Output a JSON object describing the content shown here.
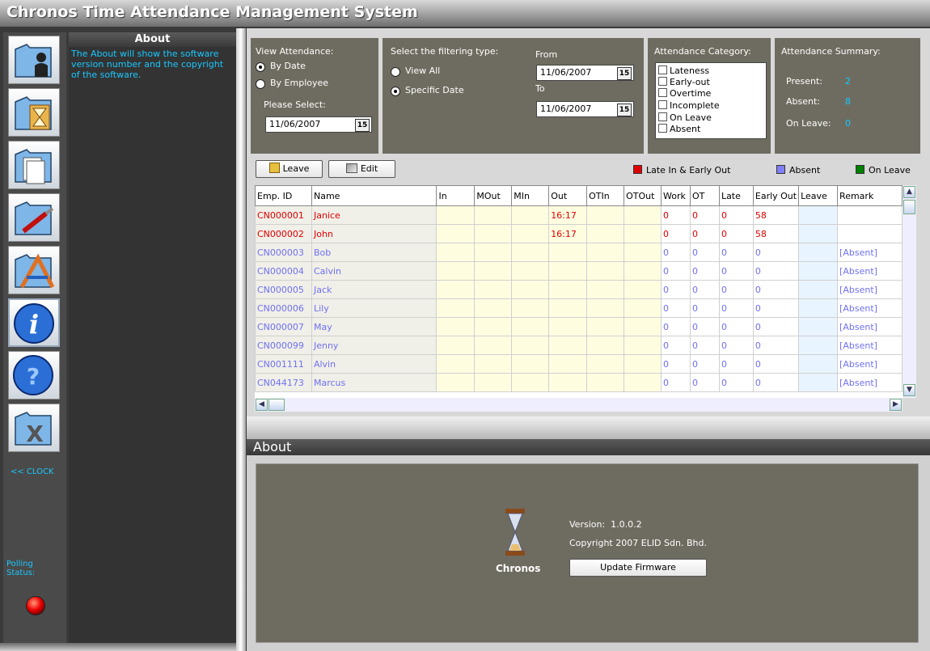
{
  "app": {
    "title": "Chronos Time Attendance Management System"
  },
  "sidebar": {
    "nav_icons": [
      "employee-icon",
      "schedule-icon",
      "report-icon",
      "tools-icon",
      "application-icon",
      "about-icon",
      "help-icon",
      "exit-icon"
    ],
    "clock_link": "<< CLOCK",
    "polling_label": "Polling\nStatus:"
  },
  "about_panel": {
    "header": "About",
    "description": "The About will show the software version number and the copyright of the software."
  },
  "filters": {
    "view_label": "View Attendance:",
    "by_date": "By Date",
    "by_employee": "By Employee",
    "please_select": "Please Select:",
    "select_date": "11/06/2007",
    "filter_type_label": "Select the filtering type:",
    "view_all": "View All",
    "specific_date": "Specific Date",
    "from_label": "From",
    "from_date": "11/06/2007",
    "to_label": "To",
    "to_date": "11/06/2007",
    "calendar_glyph": "15"
  },
  "category": {
    "label": "Attendance Category:",
    "items": [
      "Lateness",
      "Early-out",
      "Overtime",
      "Incomplete",
      "On Leave",
      "Absent"
    ]
  },
  "summary": {
    "label": "Attendance Summary:",
    "present_label": "Present:",
    "present": "2",
    "absent_label": "Absent:",
    "absent": "8",
    "onleave_label": "On Leave:",
    "onleave": "0"
  },
  "toolbar": {
    "leave": "Leave",
    "edit": "Edit"
  },
  "legend": [
    {
      "label": "Late In & Early Out",
      "color": "#e00000"
    },
    {
      "label": "Absent",
      "color": "#8080ff"
    },
    {
      "label": "On Leave",
      "color": "#008000"
    }
  ],
  "table": {
    "columns": [
      "Emp. ID",
      "Name",
      "In",
      "MOut",
      "MIn",
      "Out",
      "OTIn",
      "OTOut",
      "Work",
      "OT",
      "Late",
      "Early Out",
      "Leave",
      "Remark"
    ],
    "rows": [
      {
        "status": "late",
        "cells": [
          "CN000001",
          "Janice",
          "",
          "",
          "",
          "16:17",
          "",
          "",
          "0",
          "0",
          "0",
          "58",
          "",
          ""
        ]
      },
      {
        "status": "late",
        "cells": [
          "CN000002",
          "John",
          "",
          "",
          "",
          "16:17",
          "",
          "",
          "0",
          "0",
          "0",
          "58",
          "",
          ""
        ]
      },
      {
        "status": "absent",
        "cells": [
          "CN000003",
          "Bob",
          "",
          "",
          "",
          "",
          "",
          "",
          "0",
          "0",
          "0",
          "0",
          "",
          "[Absent]"
        ]
      },
      {
        "status": "absent",
        "cells": [
          "CN000004",
          "Calvin",
          "",
          "",
          "",
          "",
          "",
          "",
          "0",
          "0",
          "0",
          "0",
          "",
          "[Absent]"
        ]
      },
      {
        "status": "absent",
        "cells": [
          "CN000005",
          "Jack",
          "",
          "",
          "",
          "",
          "",
          "",
          "0",
          "0",
          "0",
          "0",
          "",
          "[Absent]"
        ]
      },
      {
        "status": "absent",
        "cells": [
          "CN000006",
          "Lily",
          "",
          "",
          "",
          "",
          "",
          "",
          "0",
          "0",
          "0",
          "0",
          "",
          "[Absent]"
        ]
      },
      {
        "status": "absent",
        "cells": [
          "CN000007",
          "May",
          "",
          "",
          "",
          "",
          "",
          "",
          "0",
          "0",
          "0",
          "0",
          "",
          "[Absent]"
        ]
      },
      {
        "status": "absent",
        "cells": [
          "CN000099",
          "Jenny",
          "",
          "",
          "",
          "",
          "",
          "",
          "0",
          "0",
          "0",
          "0",
          "",
          "[Absent]"
        ]
      },
      {
        "status": "absent",
        "cells": [
          "CN001111",
          "Alvin",
          "",
          "",
          "",
          "",
          "",
          "",
          "0",
          "0",
          "0",
          "0",
          "",
          "[Absent]"
        ]
      },
      {
        "status": "absent",
        "cells": [
          "CN044173",
          "Marcus",
          "",
          "",
          "",
          "",
          "",
          "",
          "0",
          "0",
          "0",
          "0",
          "",
          "[Absent]"
        ]
      }
    ]
  },
  "status_colors": {
    "late": "#e00000",
    "absent": "#7070f0"
  },
  "about_section": {
    "header": "About",
    "product": "Chronos",
    "version_label": "Version:",
    "version": "1.0.0.2",
    "copyright": "Copyright 2007 ELID Sdn. Bhd.",
    "update_button": "Update Firmware"
  }
}
